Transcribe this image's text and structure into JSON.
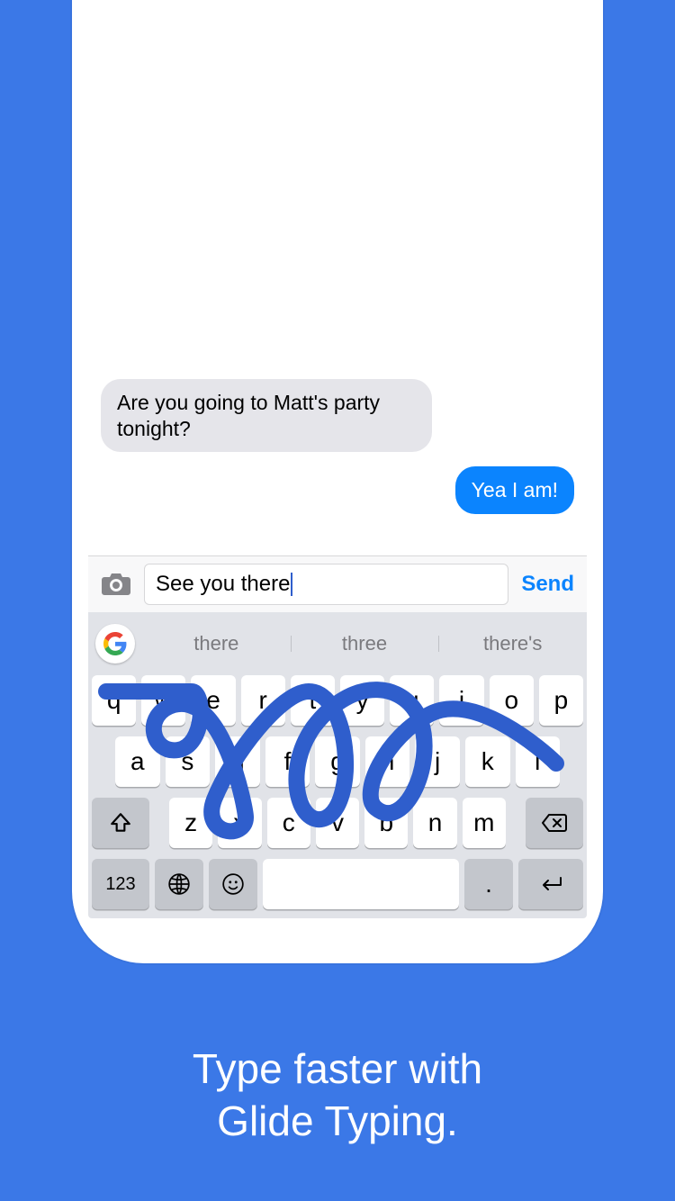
{
  "chat": {
    "incoming": "Are you going to Matt's party tonight?",
    "outgoing": "Yea I am!"
  },
  "compose": {
    "value": "See you there",
    "send_label": "Send"
  },
  "suggestions": [
    "there",
    "three",
    "there's"
  ],
  "keyboard": {
    "row1": [
      "q",
      "w",
      "e",
      "r",
      "t",
      "y",
      "u",
      "i",
      "o",
      "p"
    ],
    "row2": [
      "a",
      "s",
      "d",
      "f",
      "g",
      "h",
      "j",
      "k",
      "l"
    ],
    "row3": [
      "z",
      "x",
      "c",
      "v",
      "b",
      "n",
      "m"
    ],
    "num_label": "123",
    "dot_label": "."
  },
  "tagline": {
    "line1": "Type faster with",
    "line2": "Glide Typing."
  },
  "colors": {
    "bg": "#3b78e7",
    "bubble_out": "#0b84fe",
    "glide": "#2f5ecc"
  }
}
